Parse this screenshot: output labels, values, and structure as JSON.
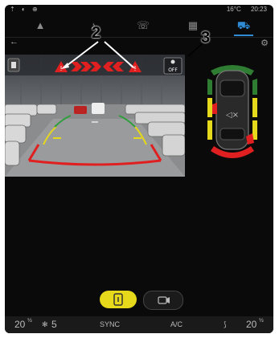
{
  "status": {
    "left_icons": "⇡ ◐ ⊕",
    "temperature": "16°C",
    "time": "20:23"
  },
  "nav": {
    "items": [
      "navigation",
      "media",
      "phone",
      "apps",
      "vehicle"
    ]
  },
  "callouts": {
    "label_2": "2",
    "label_3": "3"
  },
  "camera": {
    "off_label": "OFF"
  },
  "buttons": {
    "sensor": "sensor-view",
    "camera": "camera-view"
  },
  "climate": {
    "left_temp": "20",
    "left_temp_unit": "½",
    "fan_level": "5",
    "sync": "SYNC",
    "ac": "A/C",
    "right_temp": "20",
    "right_temp_unit": "½"
  },
  "colors": {
    "accent": "#2f8bd6",
    "warning_red": "#e02020",
    "guide_yellow": "#e6d81a",
    "sensor_green": "#2e7d32"
  }
}
